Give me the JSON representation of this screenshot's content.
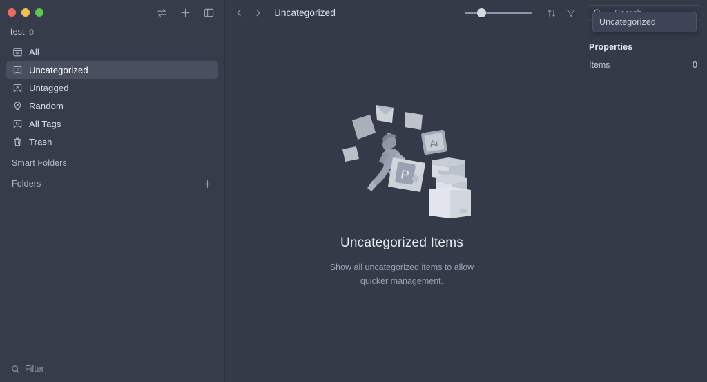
{
  "window": {
    "traffic_lights": [
      {
        "name": "close",
        "color": "#ed6a5f"
      },
      {
        "name": "minimize",
        "color": "#f5bf4f"
      },
      {
        "name": "maximize",
        "color": "#61c554"
      }
    ],
    "background": "#353a49",
    "sidebar_background": "#373c4b"
  },
  "sidebar": {
    "tools": [
      {
        "name": "sync-icon",
        "title": "Sync"
      },
      {
        "name": "plus-icon",
        "title": "Add"
      },
      {
        "name": "sidebar-toggle-icon",
        "title": "Toggle Sidebar"
      }
    ],
    "library": {
      "name": "test"
    },
    "items": [
      {
        "label": "All",
        "icon": "archive-box-icon",
        "selected": false
      },
      {
        "label": "Uncategorized",
        "icon": "question-bookmark-icon",
        "selected": true
      },
      {
        "label": "Untagged",
        "icon": "x-bookmark-icon",
        "selected": false
      },
      {
        "label": "Random",
        "icon": "lightbulb-icon",
        "selected": false
      },
      {
        "label": "All Tags",
        "icon": "tag-bookmark-icon",
        "selected": false
      },
      {
        "label": "Trash",
        "icon": "trash-icon",
        "selected": false
      }
    ],
    "sections": [
      {
        "label": "Smart Folders",
        "has_add": false
      },
      {
        "label": "Folders",
        "has_add": true
      }
    ],
    "filter": {
      "placeholder": "Filter",
      "value": ""
    }
  },
  "toolbar": {
    "back_label": "Back",
    "forward_label": "Forward",
    "breadcrumb": "Uncategorized",
    "zoom_slider": {
      "value": 18,
      "min": 0,
      "max": 100
    },
    "sort_icon": "sort-icon",
    "filter_icon": "funnel-icon",
    "search": {
      "placeholder": "Search",
      "value": ""
    }
  },
  "search_dropdown": {
    "visible": true,
    "option": "Uncategorized"
  },
  "main": {
    "empty_state": {
      "title": "Uncategorized Items",
      "description": "Show all uncategorized items to allow quicker management.",
      "illustration": "running-person-with-files-illustration",
      "file_badges": [
        "Ps",
        "Ai"
      ]
    }
  },
  "inspector": {
    "heading": "Properties",
    "rows": [
      {
        "label": "Items",
        "value": "0"
      }
    ]
  }
}
